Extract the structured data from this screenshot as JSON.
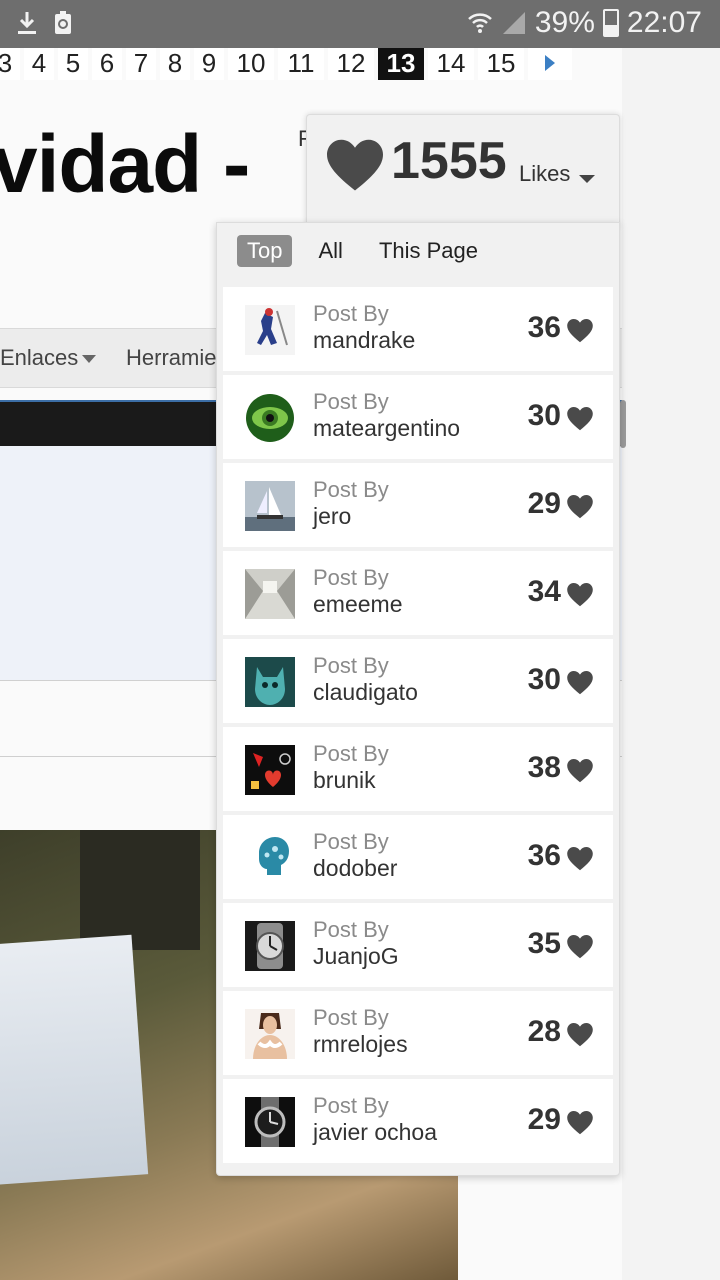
{
  "status_bar": {
    "battery": "39%",
    "time": "22:07",
    "icons": [
      "download-icon",
      "recycle-icon",
      "wifi-icon",
      "signal-icon",
      "battery-icon"
    ]
  },
  "pagination": {
    "pages": [
      "3",
      "4",
      "5",
      "6",
      "7",
      "8",
      "9",
      "10",
      "11",
      "12",
      "13",
      "14",
      "15"
    ],
    "current": "13",
    "next_icon": "chevron-right-icon"
  },
  "page": {
    "title_fragment": "vidad -",
    "stray_letter": "F",
    "nav": {
      "enlaces": "Enlaces",
      "herramientas": "Herramie"
    }
  },
  "likes": {
    "count": "1555",
    "label": "Likes",
    "tabs": [
      "Top",
      "All",
      "This Page"
    ],
    "active_tab": "Top",
    "post_by_label": "Post By",
    "entries": [
      {
        "user": "mandrake",
        "score": "36"
      },
      {
        "user": "mateargentino",
        "score": "30"
      },
      {
        "user": "jero",
        "score": "29"
      },
      {
        "user": "emeeme",
        "score": "34"
      },
      {
        "user": "claudigato",
        "score": "30"
      },
      {
        "user": "brunik",
        "score": "38"
      },
      {
        "user": "dodober",
        "score": "36"
      },
      {
        "user": "JuanjoG",
        "score": "35"
      },
      {
        "user": "rmrelojes",
        "score": "28"
      },
      {
        "user": "javier ochoa",
        "score": "29"
      }
    ]
  },
  "colors": {
    "status_bar_bg": "#6e6e6e",
    "active_page_bg": "#111111",
    "active_tab_bg": "#8c8c8c",
    "heart": "#4a4a4a",
    "link_blue": "#3b7fc4"
  }
}
